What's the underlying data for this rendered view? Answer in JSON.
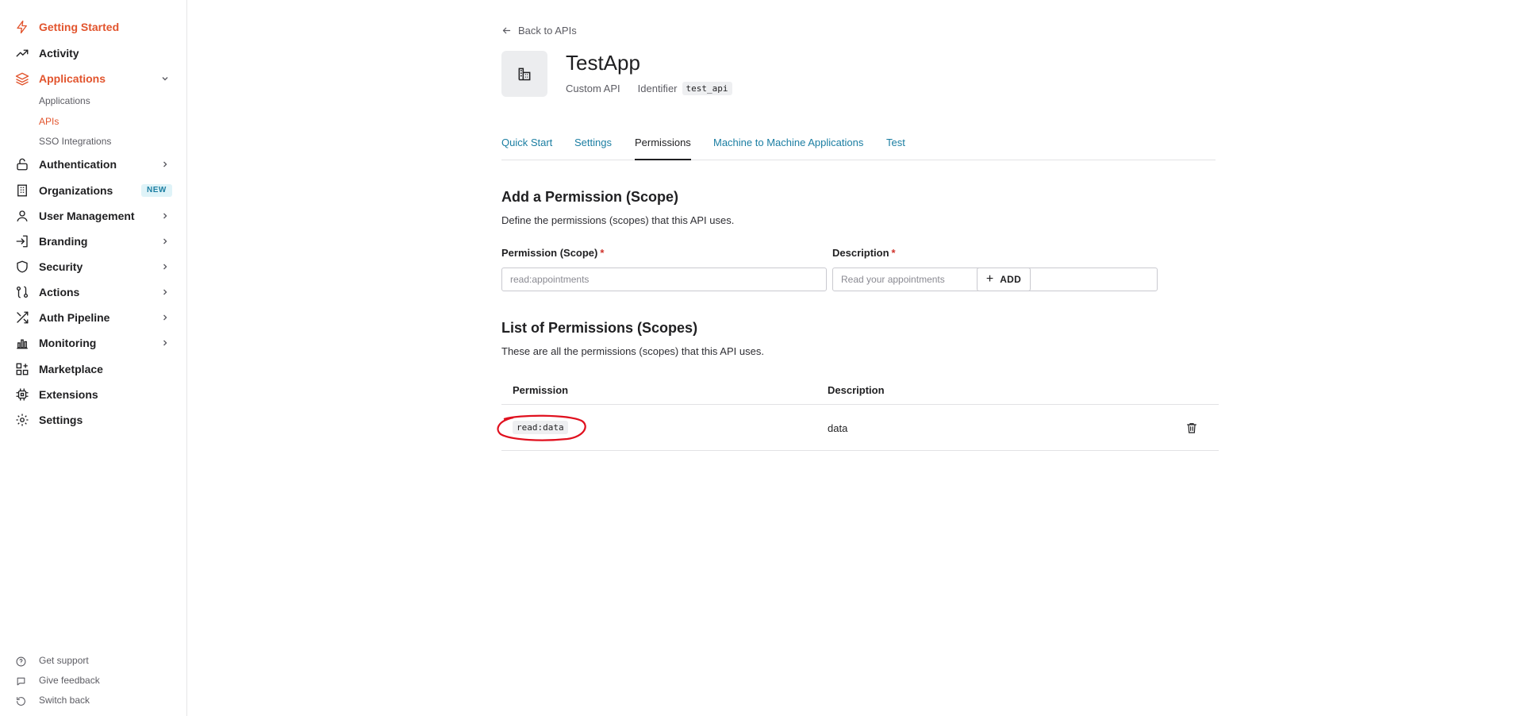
{
  "sidebar": {
    "items": [
      {
        "label": "Getting Started"
      },
      {
        "label": "Activity"
      },
      {
        "label": "Applications"
      },
      {
        "label": "Authentication"
      },
      {
        "label": "Organizations"
      },
      {
        "label": "User Management"
      },
      {
        "label": "Branding"
      },
      {
        "label": "Security"
      },
      {
        "label": "Actions"
      },
      {
        "label": "Auth Pipeline"
      },
      {
        "label": "Monitoring"
      },
      {
        "label": "Marketplace"
      },
      {
        "label": "Extensions"
      },
      {
        "label": "Settings"
      }
    ],
    "sub_items": [
      {
        "label": "Applications"
      },
      {
        "label": "APIs"
      },
      {
        "label": "SSO Integrations"
      }
    ],
    "new_badge": "NEW",
    "footer": [
      {
        "label": "Get support"
      },
      {
        "label": "Give feedback"
      },
      {
        "label": "Switch back"
      }
    ]
  },
  "header": {
    "back_label": "Back to APIs",
    "app_name": "TestApp",
    "app_type": "Custom API",
    "identifier_label": "Identifier",
    "identifier_value": "test_api"
  },
  "tabs": [
    {
      "label": "Quick Start"
    },
    {
      "label": "Settings"
    },
    {
      "label": "Permissions"
    },
    {
      "label": "Machine to Machine Applications"
    },
    {
      "label": "Test"
    }
  ],
  "add_section": {
    "title": "Add a Permission (Scope)",
    "description": "Define the permissions (scopes) that this API uses.",
    "permission_label": "Permission (Scope)",
    "permission_placeholder": "read:appointments",
    "description_label": "Description",
    "description_placeholder": "Read your appointments",
    "required_mark": "*",
    "add_button_label": "ADD"
  },
  "list_section": {
    "title": "List of Permissions (Scopes)",
    "description": "These are all the permissions (scopes) that this API uses.",
    "columns": [
      "Permission",
      "Description"
    ],
    "rows": [
      {
        "permission": "read:data",
        "description": "data"
      }
    ]
  },
  "colors": {
    "accent": "#e2542d",
    "link": "#1b7ea2",
    "annotation": "#e0101e"
  }
}
